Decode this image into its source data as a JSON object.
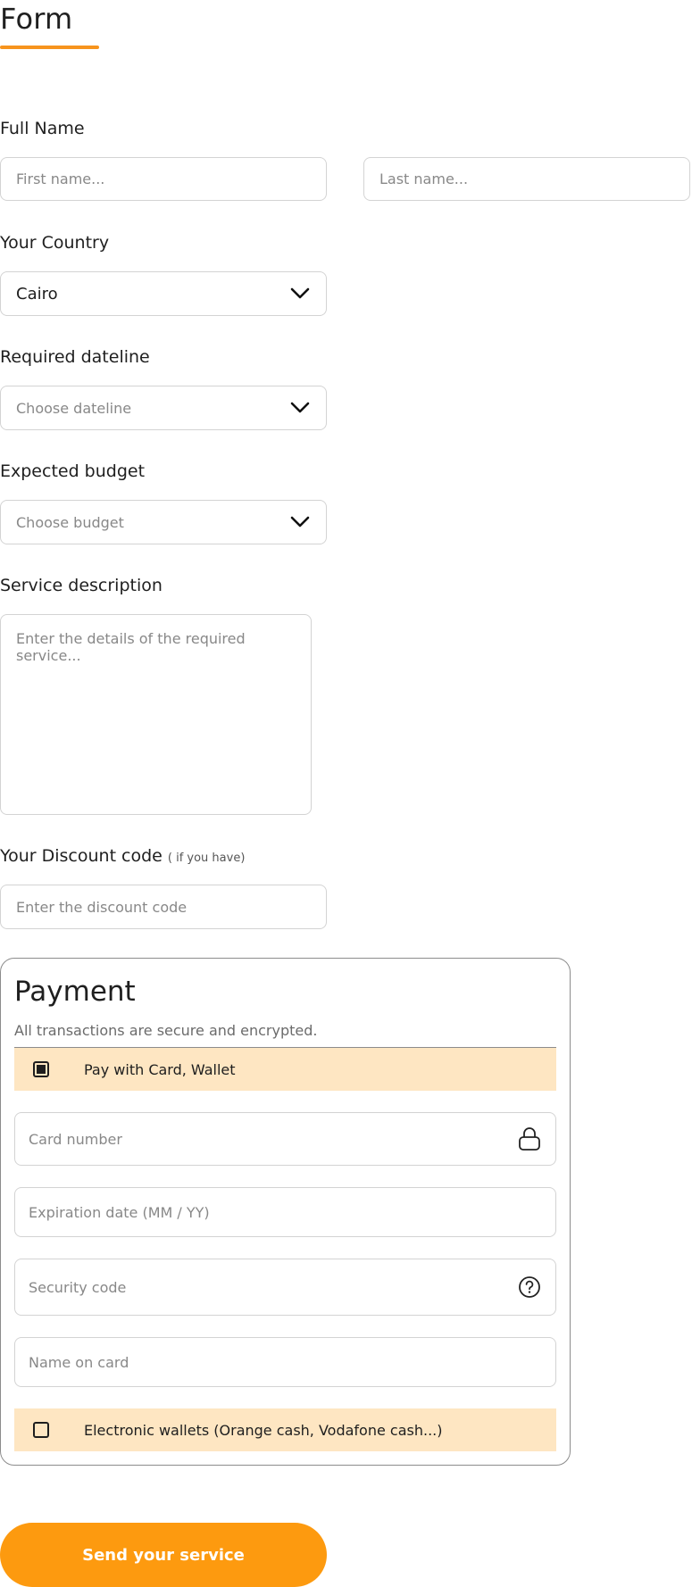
{
  "page": {
    "title": "Form"
  },
  "full_name": {
    "label": "Full Name",
    "first_placeholder": "First name...",
    "last_placeholder": "Last name..."
  },
  "country": {
    "label": "Your Country",
    "value": "Cairo"
  },
  "dateline": {
    "label": "Required dateline",
    "placeholder": "Choose dateline"
  },
  "budget": {
    "label": "Expected budget",
    "placeholder": "Choose budget"
  },
  "description": {
    "label": "Service description",
    "placeholder": "Enter the details of the required service..."
  },
  "discount": {
    "label": "Your Discount code",
    "note": "( if you have)",
    "placeholder": "Enter the discount code"
  },
  "payment": {
    "title": "Payment",
    "subtitle": "All transactions are secure and encrypted.",
    "card_option": {
      "label": "Pay with Card, Wallet",
      "checked": true
    },
    "card_number_placeholder": "Card number",
    "expiration_placeholder": "Expiration date (MM / YY)",
    "security_placeholder": "Security code",
    "name_placeholder": "Name on card",
    "wallet_option": {
      "label": "Electronic wallets (Orange cash, Vodafone cash...)",
      "checked": false
    }
  },
  "submit": {
    "label": "Send your service"
  },
  "colors": {
    "accent": "#fd9a0f",
    "option_bg": "#fee6c2",
    "border": "#d3d3d3"
  },
  "icons": {
    "select": "chevron-down-icon",
    "card": "lock-icon",
    "security": "help-circle-icon"
  }
}
